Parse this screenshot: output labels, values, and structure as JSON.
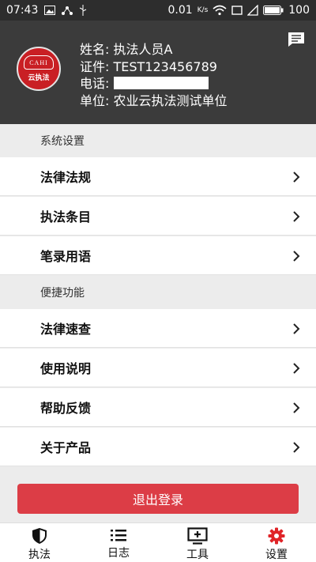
{
  "status_bar": {
    "time": "07:43",
    "speed": "0.01",
    "speed_unit": "K/s",
    "battery": "100"
  },
  "profile": {
    "name_label": "姓名:",
    "name": "执法人员A",
    "id_label": "证件:",
    "id": "TEST123456789",
    "phone_label": "电话:",
    "unit_label": "单位:",
    "unit": "农业云执法测试单位",
    "logo_top": "CAHI",
    "logo_bottom": "云执法"
  },
  "sections": [
    {
      "title": "系统设置",
      "items": [
        "法律法规",
        "执法条目",
        "笔录用语"
      ]
    },
    {
      "title": "便捷功能",
      "items": [
        "法律速查",
        "使用说明",
        "帮助反馈",
        "关于产品"
      ]
    }
  ],
  "logout_label": "退出登录",
  "tabs": [
    {
      "label": "执法",
      "icon": "shield-icon"
    },
    {
      "label": "日志",
      "icon": "list-icon"
    },
    {
      "label": "工具",
      "icon": "monitor-plus-icon"
    },
    {
      "label": "设置",
      "icon": "gear-icon",
      "active": true
    }
  ],
  "colors": {
    "header_bg": "#3b3b3b",
    "logout_bg": "#dc3d46",
    "active_tab": "#e02428"
  }
}
